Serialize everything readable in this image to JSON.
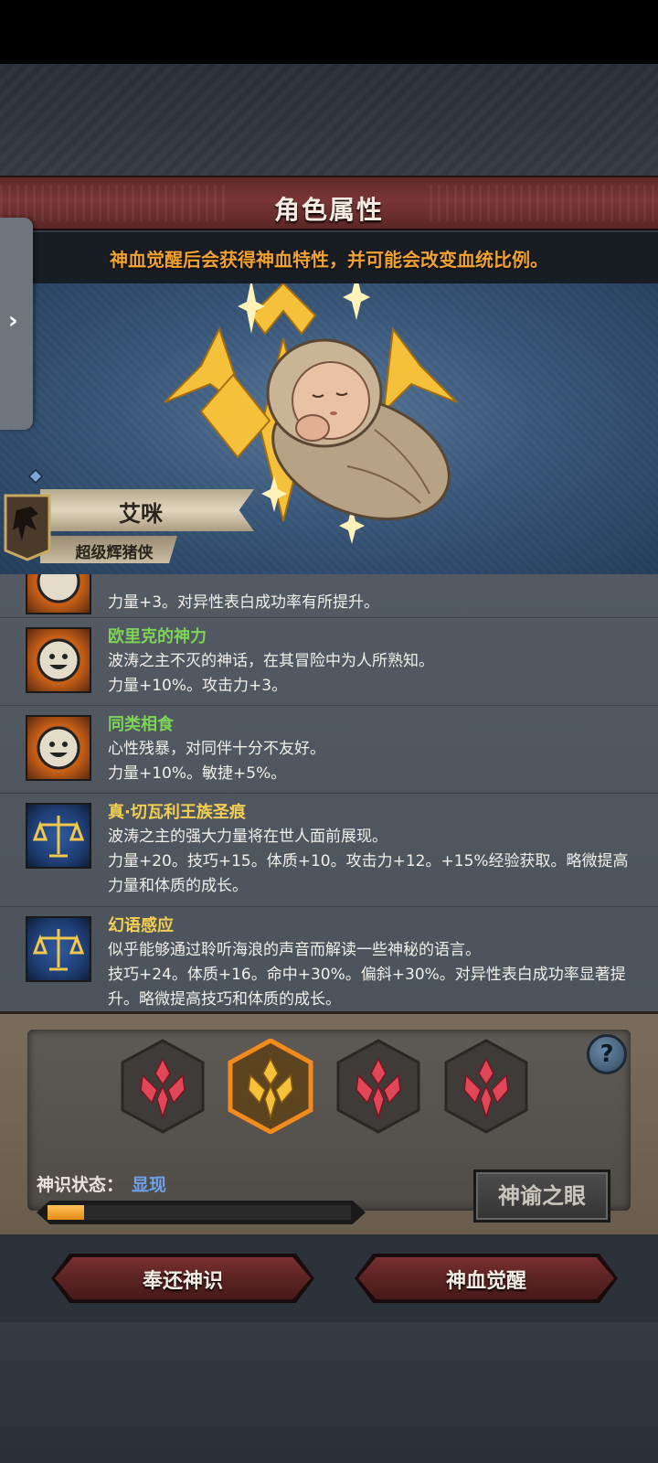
{
  "header": {
    "title": "角色属性",
    "subtitle": "神血觉醒后会获得神血特性，并可能会改变血统比例。"
  },
  "character": {
    "name": "艾咪",
    "class": "超级辉猪侠"
  },
  "traits": [
    {
      "name": "",
      "description": "",
      "effects": "力量+3。对异性表白成功率有所提升。",
      "icon": "smiley-face-icon",
      "name_color": "#7ed357"
    },
    {
      "name": "欧里克的神力",
      "description": "波涛之主不灭的神话，在其冒险中为人所熟知。",
      "effects": "力量+10%。攻击力+3。",
      "icon": "smiley-face-icon",
      "name_color": "#7ed357"
    },
    {
      "name": "同类相食",
      "description": "心性残暴，对同伴十分不友好。",
      "effects": "力量+10%。敏捷+5%。",
      "icon": "smiley-face-icon",
      "name_color": "#7ed357"
    },
    {
      "name": "真·切瓦利王族圣痕",
      "description": "波涛之主的强大力量将在世人面前展现。",
      "effects": "力量+20。技巧+15。体质+10。攻击力+12。+15%经验获取。略微提高力量和体质的成长。",
      "icon": "balance-scale-icon",
      "name_color": "#f2cf52"
    },
    {
      "name": "幻语感应",
      "description": "似乎能够通过聆听海浪的声音而解读一些神秘的语言。",
      "effects": "技巧+24。体质+16。命中+30%。偏斜+30%。对异性表白成功率显著提升。略微提高技巧和体质的成长。",
      "icon": "balance-scale-icon",
      "name_color": "#f2cf52"
    }
  ],
  "divine_sense": {
    "status_label": "神识状态：",
    "status_value": "显现",
    "progress": 0.12,
    "help_label": "?",
    "oracle_button": "神谕之眼",
    "slots": [
      {
        "icon": "red-rune-icon",
        "selected": false
      },
      {
        "icon": "gold-rune-icon",
        "selected": true
      },
      {
        "icon": "red-rune-icon",
        "selected": false
      },
      {
        "icon": "red-rune-icon",
        "selected": false
      }
    ]
  },
  "footer": {
    "return_button": "奉还神识",
    "awaken_button": "神血觉醒"
  },
  "colors": {
    "accent_orange": "#f0a233",
    "trait_green": "#7ed357",
    "trait_gold": "#f2cf52",
    "status_blue": "#6ea0e8",
    "button_red": "#6a2828"
  }
}
